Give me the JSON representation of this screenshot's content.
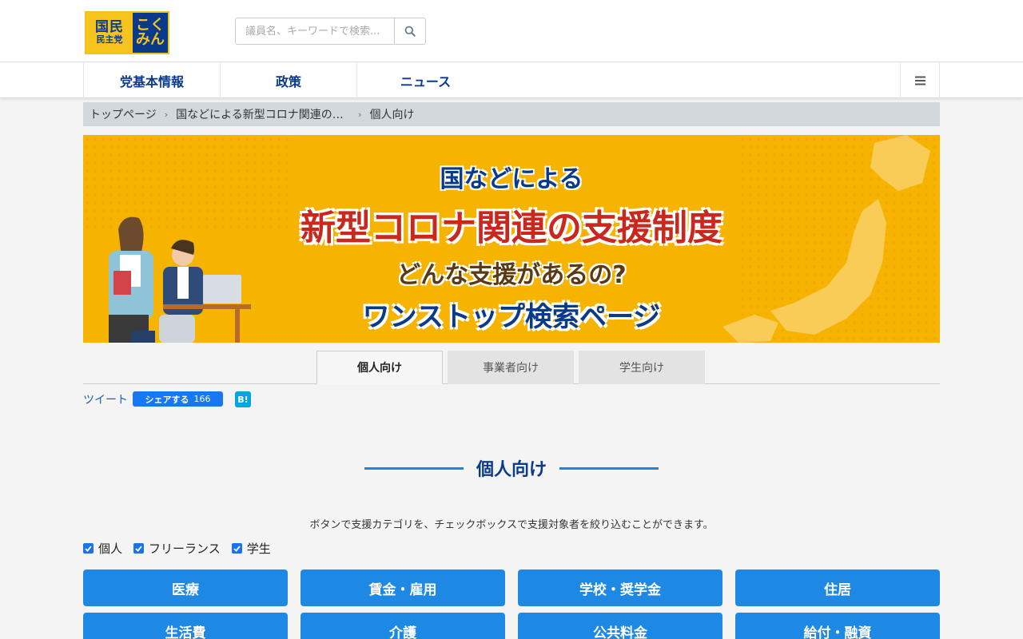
{
  "header": {
    "logo": {
      "line1": "国民",
      "line2": "民主党",
      "side1": "こく",
      "side2": "みん"
    },
    "search": {
      "placeholder": "議員名、キーワードで検索..."
    }
  },
  "nav": {
    "items": [
      {
        "label": "党基本情報"
      },
      {
        "label": "政策"
      },
      {
        "label": "ニュース"
      }
    ],
    "menu_icon": "hamburger-icon"
  },
  "breadcrumb": {
    "items": [
      "トップページ",
      "国などによる新型コロナ関連の支援制度",
      "個人向け"
    ]
  },
  "banner": {
    "line1": "国などによる",
    "line2": "新型コロナ関連の支援制度",
    "line3": "どんな支援があるの?",
    "line4": "ワンストップ検索ページ"
  },
  "tabs": [
    {
      "label": "個人向け",
      "active": true
    },
    {
      "label": "事業者向け",
      "active": false
    },
    {
      "label": "学生向け",
      "active": false
    }
  ],
  "share": {
    "tweet": "ツイート",
    "fb_label": "シェアする",
    "fb_count": "166",
    "hatena": "B!"
  },
  "section": {
    "title": "個人向け",
    "description": "ボタンで支援カテゴリを、チェックボックスで支援対象者を絞り込むことができます。"
  },
  "filters": [
    {
      "label": "個人",
      "checked": true
    },
    {
      "label": "フリーランス",
      "checked": true
    },
    {
      "label": "学生",
      "checked": true
    }
  ],
  "categories": [
    {
      "label": "医療"
    },
    {
      "label": "賃金・雇用"
    },
    {
      "label": "学校・奨学金"
    },
    {
      "label": "住居"
    },
    {
      "label": "生活費"
    },
    {
      "label": "介護"
    },
    {
      "label": "公共料金"
    },
    {
      "label": "給付・融資"
    }
  ],
  "colors": {
    "brand_navy": "#0a3a8a",
    "brand_yellow": "#f7c31d",
    "button_blue": "#1e88e5",
    "banner_bg": "#f6b400"
  }
}
